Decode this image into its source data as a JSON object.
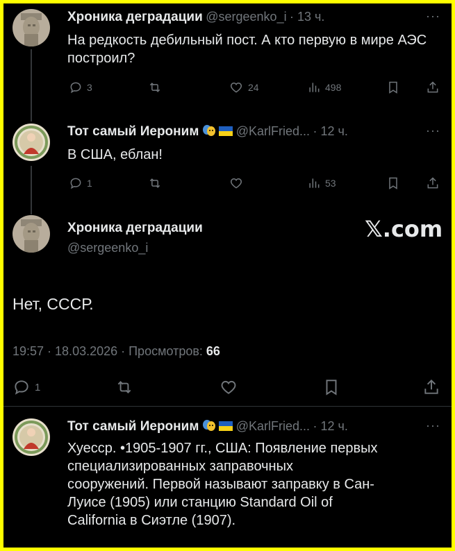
{
  "tweet1": {
    "name": "Хроника деградации",
    "handle": "@sergeenko_i",
    "time": "· 13 ч.",
    "text": "На редкость дебильный пост. А кто первую в мире АЭС построил?",
    "replies": "3",
    "reposts": "",
    "likes": "24",
    "views": "498"
  },
  "tweet2": {
    "name": "Тот самый Иероним",
    "handle": "@KarlFried...",
    "time": "· 12 ч.",
    "text": "В США, еблан!",
    "replies": "1",
    "likes": "",
    "views": "53"
  },
  "main": {
    "name": "Хроника деградации",
    "handle": "@sergeenko_i",
    "site": "𝕏.com",
    "text": "Нет, СССР.",
    "timestamp": "19:57 · 18.03.2026 · Просмотров:",
    "views": "66",
    "replies": "1"
  },
  "tweet3": {
    "name": "Тот самый Иероним",
    "handle": "@KarlFried...",
    "time": "· 12 ч.",
    "text_lines": [
      "Хуесср. •1905-1907 гг., США: Появление первых",
      "специализированных заправочных",
      "сооружений. Первой называют заправку в Сан-",
      "Луисе (1905) или станцию Standard Oil of",
      "California в Сиэтле (1907)."
    ]
  },
  "more_label": "···",
  "colors": {
    "background": "#000000",
    "frame": "#ffff00",
    "text": "#e7e9ea",
    "muted": "#71767b"
  }
}
